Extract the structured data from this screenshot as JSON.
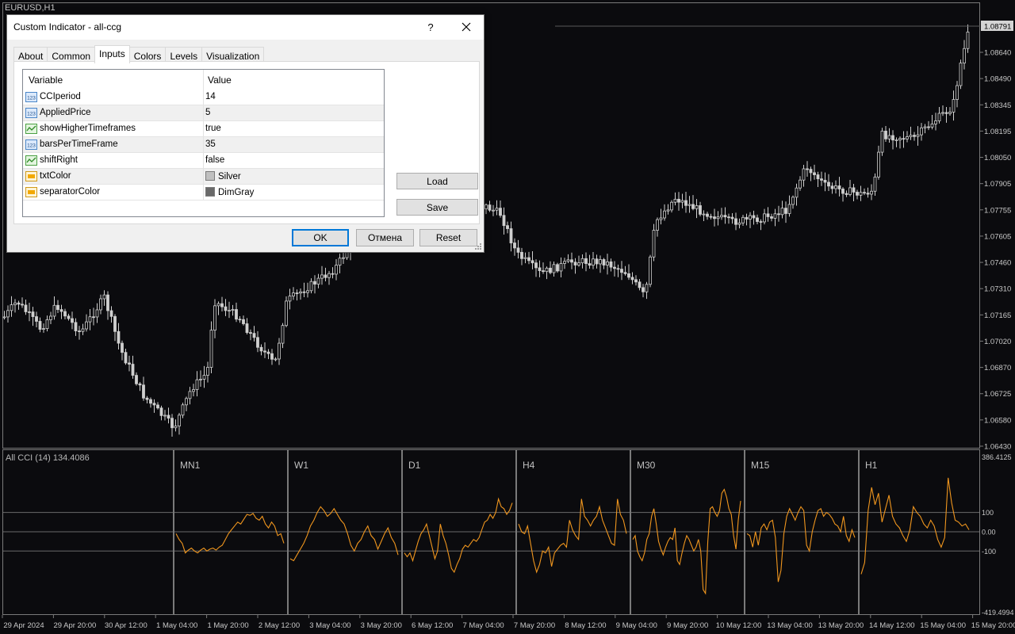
{
  "chart": {
    "symbol_label": "EURUSD,H1",
    "current_price": "1.08791",
    "price_axis": [
      "1.08640",
      "1.08490",
      "1.08345",
      "1.08195",
      "1.08050",
      "1.07905",
      "1.07755",
      "1.07605",
      "1.07460",
      "1.07310",
      "1.07165",
      "1.07020",
      "1.06870",
      "1.06725",
      "1.06580",
      "1.06430"
    ],
    "time_axis": [
      "29 Apr 2024",
      "29 Apr 20:00",
      "30 Apr 12:00",
      "1 May 04:00",
      "1 May 20:00",
      "2 May 12:00",
      "3 May 04:00",
      "3 May 20:00",
      "6 May 12:00",
      "7 May 04:00",
      "7 May 20:00",
      "8 May 12:00",
      "9 May 04:00",
      "9 May 20:00",
      "10 May 12:00",
      "13 May 04:00",
      "13 May 20:00",
      "14 May 12:00",
      "15 May 04:00",
      "15 May 20:00"
    ]
  },
  "indicator": {
    "label": "All CCI (14) 134.4086",
    "scale_top": "386.4125",
    "scale_bottom": "-419.4994",
    "levels": [
      "100",
      "0.00",
      "-100"
    ],
    "timeframes": [
      "MN1",
      "W1",
      "D1",
      "H4",
      "M30",
      "M15",
      "H1"
    ],
    "line_color": "#f0961e"
  },
  "chart_data": {
    "type": "line",
    "series": [
      {
        "name": "MN1",
        "values": [
          -10,
          -40,
          -60,
          -110,
          -95,
          -85,
          -100,
          -110,
          -95,
          -85,
          -100,
          -90,
          -85,
          -95,
          -80,
          -70,
          -40,
          -10,
          10,
          30,
          50,
          40,
          65,
          90,
          85,
          95,
          70,
          60,
          80,
          40,
          20,
          50,
          30,
          -20,
          -10,
          -60
        ]
      },
      {
        "name": "W1",
        "values": [
          -140,
          -150,
          -120,
          -90,
          -60,
          -20,
          30,
          60,
          100,
          130,
          110,
          80,
          95,
          120,
          90,
          60,
          40,
          -10,
          -70,
          -100,
          -60,
          -40,
          0,
          30,
          -20,
          -40,
          -90,
          -50,
          -10,
          20,
          -30,
          -60,
          -120
        ]
      },
      {
        "name": "D1",
        "values": [
          -110,
          -130,
          -110,
          -150,
          -100,
          -50,
          -10,
          10,
          40,
          -20,
          -80,
          -140,
          -100,
          40,
          -20,
          -60,
          -120,
          -190,
          -210,
          -170,
          -140,
          -90,
          -70,
          -80,
          -60,
          -40,
          -50,
          -30,
          10,
          50,
          60,
          90,
          70,
          100,
          170,
          130,
          120,
          90,
          110,
          150
        ]
      },
      {
        "name": "H4",
        "values": [
          40,
          0,
          -10,
          30,
          -60,
          -150,
          -210,
          -170,
          -100,
          -110,
          -80,
          -180,
          -110,
          -90,
          -70,
          -60,
          -80,
          60,
          10,
          -20,
          -40,
          170,
          80,
          60,
          30,
          60,
          80,
          130,
          60,
          20,
          -20,
          -60,
          -70,
          170,
          90,
          60,
          -10
        ]
      },
      {
        "name": "M30",
        "values": [
          -40,
          -20,
          -100,
          -130,
          -150,
          -110,
          -40,
          -10,
          80,
          120,
          40,
          -50,
          -90,
          -120,
          -80,
          -50,
          -30,
          -40,
          20,
          -150,
          -170,
          -110,
          -60,
          -20,
          -40,
          -70,
          -100,
          -80,
          -40,
          -100,
          -300,
          -320,
          -50,
          120,
          130,
          100,
          80,
          110,
          200,
          220,
          180,
          120,
          90,
          -20,
          -90,
          60,
          160
        ]
      },
      {
        "name": "M15",
        "values": [
          -10,
          -20,
          -80,
          0,
          -70,
          20,
          40,
          10,
          50,
          60,
          -30,
          -260,
          -200,
          -10,
          80,
          120,
          90,
          60,
          100,
          130,
          110,
          -70,
          -100,
          0,
          60,
          110,
          120,
          80,
          100,
          90,
          70,
          40,
          30,
          0,
          80,
          -20,
          -50,
          10,
          -30
        ]
      },
      {
        "name": "H1",
        "values": [
          -220,
          -160,
          110,
          230,
          140,
          200,
          50,
          120,
          190,
          80,
          40,
          20,
          -20,
          -50,
          10,
          130,
          100,
          80,
          40,
          20,
          60,
          30,
          -40,
          -80,
          -30,
          280,
          150,
          60,
          50,
          30,
          40,
          10
        ]
      }
    ],
    "levels": [
      100,
      0,
      -100
    ],
    "ylim": [
      -419.4994,
      386.4125
    ]
  },
  "dialog": {
    "title": "Custom Indicator - all-ccg",
    "help_label": "?",
    "close_label": "✕",
    "tabs": [
      "About",
      "Common",
      "Inputs",
      "Colors",
      "Levels",
      "Visualization"
    ],
    "active_tab": "Inputs",
    "columns": [
      "Variable",
      "Value"
    ],
    "rows": [
      {
        "name": "CCIperiod",
        "value": "14",
        "icon": "numeric-icon"
      },
      {
        "name": "AppliedPrice",
        "value": "5",
        "icon": "numeric-icon"
      },
      {
        "name": "showHigherTimeframes",
        "value": "true",
        "icon": "boolean-icon"
      },
      {
        "name": "barsPerTimeFrame",
        "value": "35",
        "icon": "numeric-icon"
      },
      {
        "name": "shiftRight",
        "value": "false",
        "icon": "boolean-icon"
      },
      {
        "name": "txtColor",
        "value": "Silver",
        "icon": "color-icon",
        "swatch": "#c0c0c0"
      },
      {
        "name": "separatorColor",
        "value": "DimGray",
        "icon": "color-icon",
        "swatch": "#696969"
      }
    ],
    "load_label": "Load",
    "save_label": "Save",
    "ok_label": "OK",
    "cancel_label": "Отмена",
    "reset_label": "Reset"
  },
  "colors": {
    "background": "#0b0b0e",
    "candle": "#cfcfcf",
    "grid_level": "#6a6a6a",
    "separator": "#696969",
    "accent": "#0078d7"
  }
}
